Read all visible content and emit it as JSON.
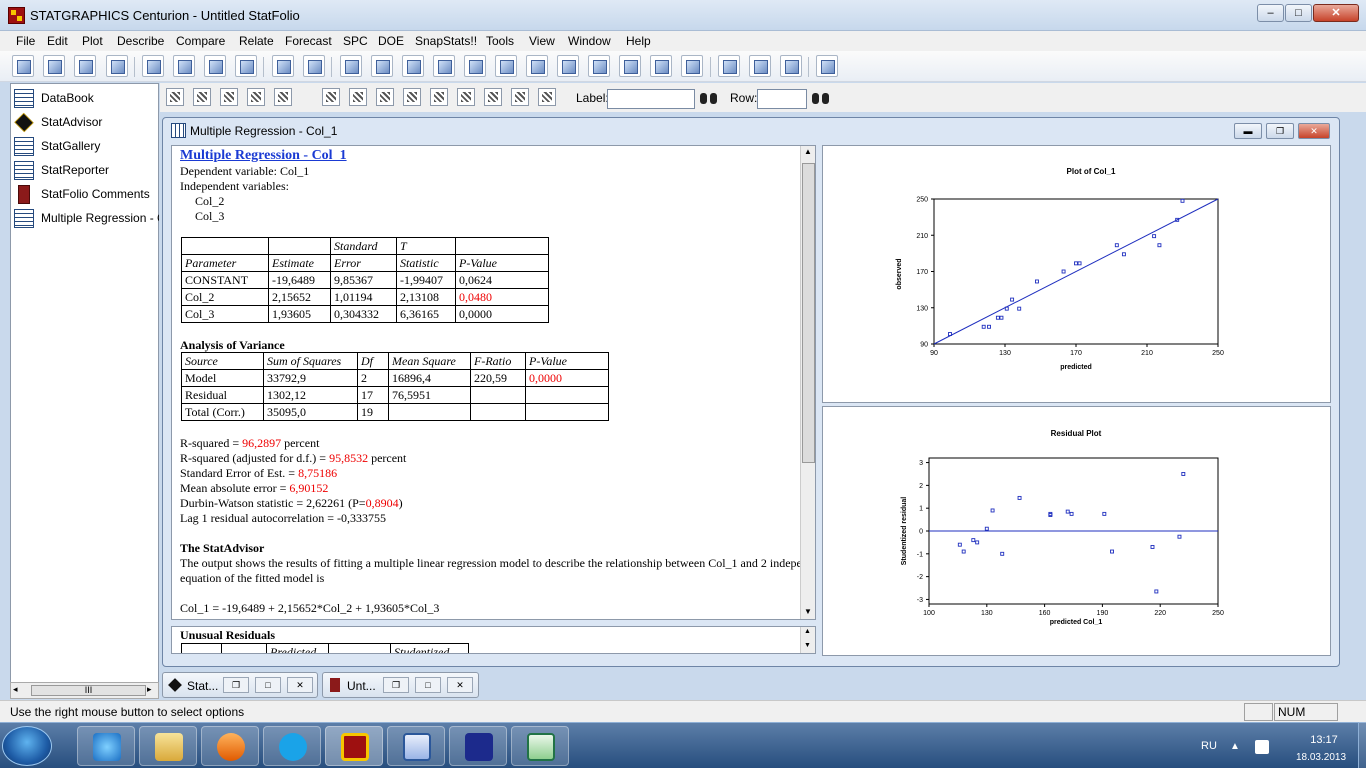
{
  "app": {
    "title": "STATGRAPHICS Centurion - Untitled StatFolio",
    "caption_buttons": {
      "minimize": "–",
      "maximize": "□",
      "close": "✕"
    }
  },
  "menu": [
    "File",
    "Edit",
    "Plot",
    "Describe",
    "Compare",
    "Relate",
    "Forecast",
    "SPC",
    "DOE",
    "SnapStats!!",
    "Tools",
    "View",
    "Window",
    "Help"
  ],
  "toolbar2": {
    "label_text": "Label:",
    "row_text": "Row:"
  },
  "nav": [
    {
      "label": "DataBook",
      "icon": "databook-icon"
    },
    {
      "label": "StatAdvisor",
      "icon": "statadvisor-icon"
    },
    {
      "label": "StatGallery",
      "icon": "statgallery-icon"
    },
    {
      "label": "StatReporter",
      "icon": "statreporter-icon"
    },
    {
      "label": "StatFolio Comments",
      "icon": "statfolio-comments-icon"
    },
    {
      "label": "Multiple Regression - Col_",
      "icon": "multiple-regression-icon"
    }
  ],
  "nav_scroll_thumb": "III",
  "child_window": {
    "title": "Multiple Regression - Col_1",
    "buttons": {
      "minimize": "▬",
      "restore": "❐",
      "close": "✕"
    }
  },
  "report": {
    "heading": "Multiple Regression - Col_1",
    "dependent": "Dependent variable: Col_1",
    "independent_label": "Independent variables:",
    "independent": [
      "Col_2",
      "Col_3"
    ],
    "coef_table": {
      "header1": [
        "",
        "",
        "Standard",
        "T",
        ""
      ],
      "header2": [
        "Parameter",
        "Estimate",
        "Error",
        "Statistic",
        "P-Value"
      ],
      "rows": [
        [
          "CONSTANT",
          "-19,6489",
          "9,85367",
          "-1,99407",
          "0,0624"
        ],
        [
          "Col_2",
          "2,15652",
          "1,01194",
          "2,13108",
          "0,0480"
        ],
        [
          "Col_3",
          "1,93605",
          "0,304332",
          "6,36165",
          "0,0000"
        ]
      ],
      "red_cell": "0,0480"
    },
    "anova_title": "Analysis of Variance",
    "anova_table": {
      "header": [
        "Source",
        "Sum of Squares",
        "Df",
        "Mean Square",
        "F-Ratio",
        "P-Value"
      ],
      "rows": [
        [
          "Model",
          "33792,9",
          "2",
          "16896,4",
          "220,59",
          "0,0000"
        ],
        [
          "Residual",
          "1302,12",
          "17",
          "76,5951",
          "",
          ""
        ],
        [
          "Total (Corr.)",
          "35095,0",
          "19",
          "",
          "",
          ""
        ]
      ]
    },
    "stats": {
      "r2_label": "R-squared = ",
      "r2_value": "96,2897",
      "r2_unit": " percent",
      "r2adj_label": "R-squared (adjusted for d.f.) = ",
      "r2adj_value": "95,8532",
      "r2adj_unit": " percent",
      "se_label": "Standard Error of Est. = ",
      "se_value": "8,75186",
      "mae_label": "Mean absolute error = ",
      "mae_value": "6,90152",
      "dw_label": "Durbin-Watson statistic = 2,62261 (P=",
      "dw_p": "0,8904",
      "dw_close": ")",
      "lag1": "Lag 1 residual autocorrelation = -0,333755"
    },
    "advisor_title": "The StatAdvisor",
    "advisor_line1": "The output shows the results of fitting a multiple linear regression model to describe the relationship between Col_1 and 2 indepe",
    "advisor_line2": "equation of the fitted model is",
    "equation": "Col_1 = -19,6489 + 2,15652*Col_2 + 1,93605*Col_3"
  },
  "report2": {
    "title": "Unusual Residuals",
    "header": [
      "",
      "",
      "Predicted",
      "",
      "Studentized"
    ]
  },
  "chart_data": [
    {
      "type": "scatter",
      "title": "Plot of Col_1",
      "xlabel": "predicted",
      "ylabel": "observed",
      "xlim": [
        90,
        250
      ],
      "ylim": [
        90,
        250
      ],
      "xticks": [
        "90",
        "130",
        "170",
        "210",
        "250"
      ],
      "yticks": [
        "90",
        "130",
        "170",
        "210",
        "250"
      ],
      "points": [
        [
          99,
          101
        ],
        [
          118,
          109
        ],
        [
          121,
          109
        ],
        [
          126,
          119
        ],
        [
          128,
          119
        ],
        [
          131,
          129
        ],
        [
          134,
          139
        ],
        [
          138,
          129
        ],
        [
          148,
          159
        ],
        [
          163,
          170
        ],
        [
          170,
          179
        ],
        [
          172,
          179
        ],
        [
          193,
          199
        ],
        [
          197,
          189
        ],
        [
          214,
          209
        ],
        [
          217,
          199
        ],
        [
          227,
          227
        ],
        [
          230,
          248
        ]
      ],
      "fit_line": [
        [
          90,
          90
        ],
        [
          250,
          250
        ]
      ],
      "grid": false
    },
    {
      "type": "scatter",
      "title": "Residual Plot",
      "xlabel": "predicted Col_1",
      "ylabel": "Studentized residual",
      "xlim": [
        100,
        250
      ],
      "ylim": [
        -3.2,
        3.2
      ],
      "xticks": [
        "100",
        "130",
        "160",
        "190",
        "220",
        "250"
      ],
      "yticks": [
        "3",
        "2",
        "1",
        "0",
        "-1",
        "-2",
        "-3"
      ],
      "points": [
        [
          116,
          -0.6
        ],
        [
          118,
          -0.9
        ],
        [
          123,
          -0.4
        ],
        [
          125,
          -0.5
        ],
        [
          130,
          0.1
        ],
        [
          133,
          0.9
        ],
        [
          138,
          -1.0
        ],
        [
          147,
          1.45
        ],
        [
          163,
          0.75
        ],
        [
          163,
          0.7
        ],
        [
          172,
          0.85
        ],
        [
          174,
          0.75
        ],
        [
          191,
          0.75
        ],
        [
          195,
          -0.9
        ],
        [
          216,
          -0.7
        ],
        [
          218,
          -2.65
        ],
        [
          230,
          -0.25
        ],
        [
          232,
          2.5
        ]
      ],
      "zero_line": 0,
      "grid": false
    }
  ],
  "bottom_tabs": [
    {
      "label": "Stat..."
    },
    {
      "label": "Unt..."
    }
  ],
  "status": {
    "text": "Use the right mouse button to select options",
    "num": "NUM"
  },
  "taskbar": {
    "lang": "RU",
    "time": "13:17",
    "date": "18.03.2013",
    "apps": [
      "internet-explorer-icon",
      "file-explorer-icon",
      "media-player-icon",
      "skype-icon",
      "statgraphics-icon",
      "word-icon",
      "save-icon",
      "excel-icon"
    ]
  }
}
